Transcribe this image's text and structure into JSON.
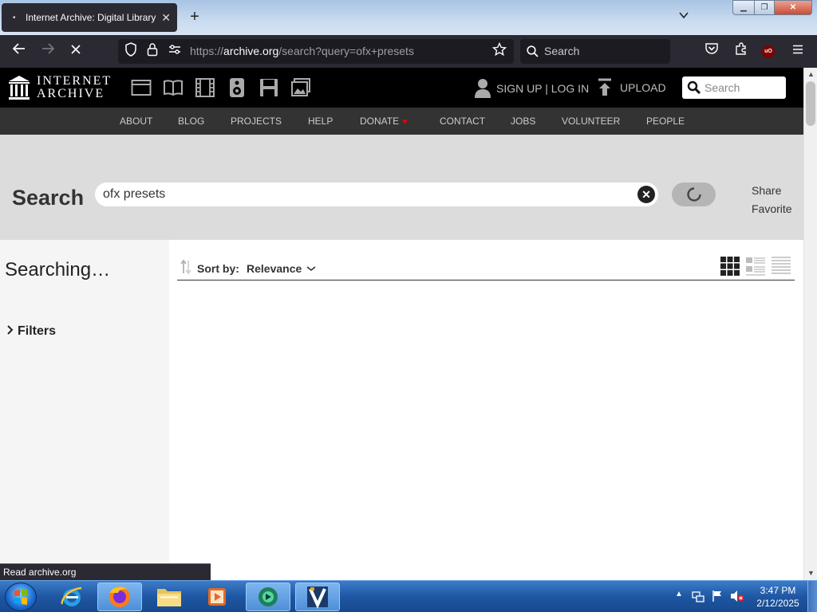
{
  "browser": {
    "tab_title": "Internet Archive: Digital Library",
    "url_host": "archive.org",
    "url_prefix": "https://",
    "url_path": "/search?query=ofx+presets",
    "search_placeholder": "Search"
  },
  "ia_header": {
    "logo_line1": "INTERNET",
    "logo_line2": "ARCHIVE",
    "signup_label": "SIGN UP | LOG IN",
    "upload_label": "UPLOAD",
    "search_placeholder": "Search",
    "media_icons": [
      "web-icon",
      "texts-icon",
      "video-icon",
      "audio-icon",
      "software-icon",
      "images-icon"
    ]
  },
  "ia_nav": {
    "items": [
      "ABOUT",
      "BLOG",
      "PROJECTS",
      "HELP",
      "DONATE",
      "CONTACT",
      "JOBS",
      "VOLUNTEER",
      "PEOPLE"
    ]
  },
  "search_band": {
    "heading": "Search",
    "query": "ofx presets",
    "share_label": "Share",
    "favorite_label": "Favorite"
  },
  "sidebar": {
    "status": "Searching…",
    "filters_label": "Filters"
  },
  "results": {
    "sort_label": "Sort by:",
    "sort_value": "Relevance"
  },
  "status_bar": {
    "text": "Read archive.org"
  },
  "taskbar": {
    "time": "3:47 PM",
    "date": "2/12/2025"
  },
  "colors": {
    "browser_chrome": "#2b2a33",
    "ia_header": "#000000",
    "ia_subnav": "#333333",
    "search_band": "#dcdcdc",
    "donate_heart": "#ee0000"
  }
}
